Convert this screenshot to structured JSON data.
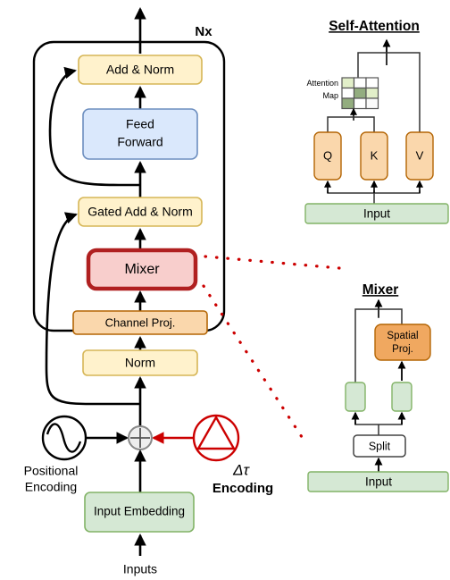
{
  "figure": {
    "type": "architecture-diagram",
    "background": "#ffffff"
  },
  "palette": {
    "yellow_fill": "#fff2cc",
    "yellow_stroke": "#d6b656",
    "blue_fill": "#dae8fc",
    "blue_stroke": "#6c8ebf",
    "pink_fill": "#f8cecc",
    "red_stroke": "#b02020",
    "orange_fill": "#fad7ac",
    "orange_stroke": "#b46504",
    "green_fill": "#d5e8d4",
    "green_stroke": "#82b366",
    "white_fill": "#ffffff",
    "gray_stroke": "#666666",
    "black": "#000000",
    "red_accent": "#cc0000",
    "attn_light": "#e2efc9",
    "attn_mid": "#93ad7f",
    "attn_empty": "#ffffff"
  },
  "main_block": {
    "repeat_label": "Nx",
    "boxes": {
      "add_norm": "Add & Norm",
      "feed_forward": "Feed\nForward",
      "feed_forward_line1": "Feed",
      "feed_forward_line2": "Forward",
      "gated_add_norm": "Gated Add & Norm",
      "mixer": "Mixer",
      "channel_proj": "Channel Proj.",
      "norm": "Norm",
      "input_embedding": "Input Embedding"
    },
    "positional_encoding": {
      "label_line1": "Positional",
      "label_line2": "Encoding",
      "icon": "sine-wave-circle-icon"
    },
    "delta_tau_encoding": {
      "symbol": "Δτ",
      "label": "Encoding",
      "icon": "triangle-in-circle-icon",
      "color": "#cc0000"
    },
    "sum_node": {
      "icon": "plus-circle-icon",
      "symbol": "+"
    },
    "inputs_label": "Inputs"
  },
  "self_attention_panel": {
    "title": "Self-Attention",
    "attention_map_label_line1": "Attention",
    "attention_map_label_line2": "Map",
    "projections": [
      "Q",
      "K",
      "V"
    ],
    "input_label": "Input",
    "attention_map": {
      "rows": 3,
      "cols": 3,
      "cells": [
        [
          "light",
          "empty",
          "empty"
        ],
        [
          "empty",
          "mid",
          "light"
        ],
        [
          "mid",
          "empty",
          "empty"
        ]
      ]
    }
  },
  "mixer_panel": {
    "title": "Mixer",
    "spatial_proj_line1": "Spatial",
    "spatial_proj_line2": "Proj.",
    "split_label": "Split",
    "input_label": "Input",
    "gate_branches": 2
  }
}
